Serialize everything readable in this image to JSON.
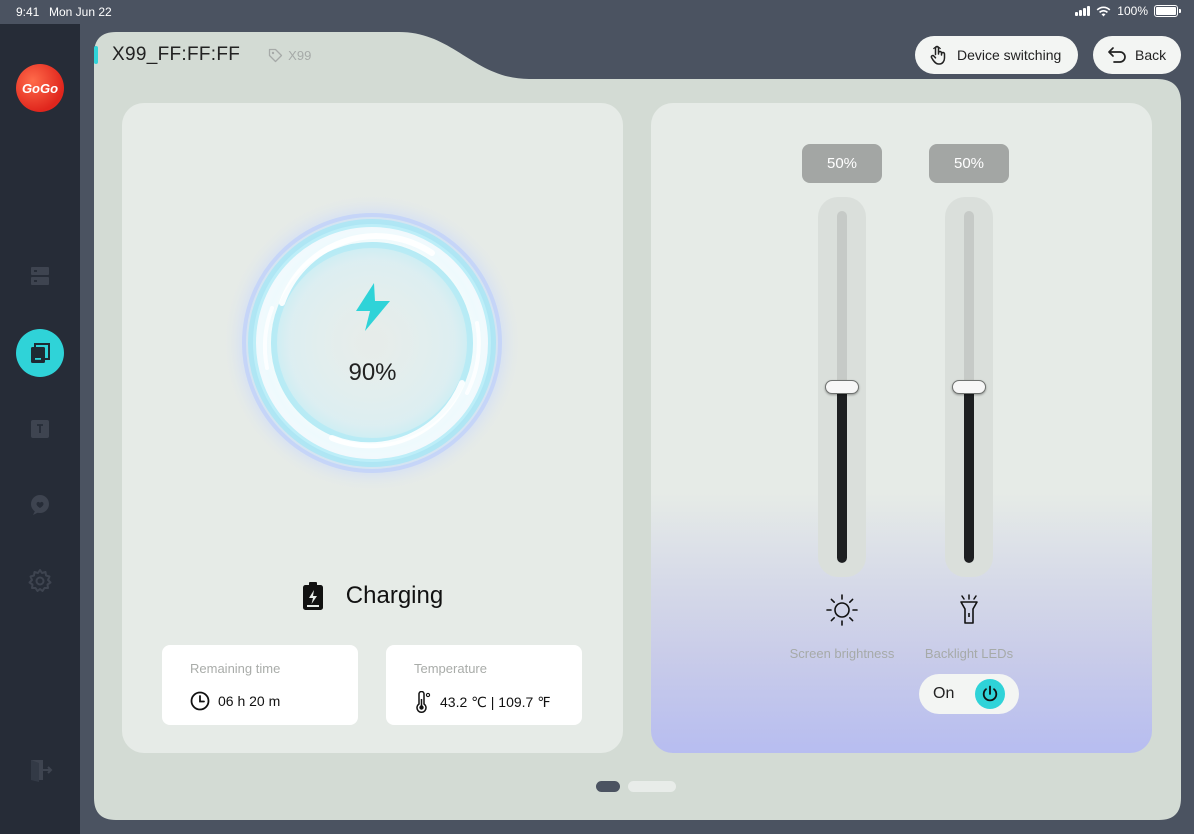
{
  "status_bar": {
    "time": "9:41",
    "date": "Mon Jun 22",
    "battery": "100%"
  },
  "app": {
    "logo_text": "GoGo"
  },
  "sidebar": {
    "items": [
      {
        "icon": "server-icon",
        "active": false
      },
      {
        "icon": "device-icon",
        "active": true
      },
      {
        "icon": "text-box-icon",
        "active": false
      },
      {
        "icon": "chat-icon",
        "active": false
      },
      {
        "icon": "gear-icon",
        "active": false
      },
      {
        "icon": "logout-icon",
        "active": false
      }
    ],
    "accent_color": "#2fd3d8"
  },
  "header": {
    "device_name": "X99_FF:FF:FF",
    "tag": "X99",
    "device_switching_label": "Device switching",
    "back_label": "Back"
  },
  "battery_panel": {
    "percent": "90%",
    "status": "Charging",
    "remaining_time": {
      "label": "Remaining time",
      "value": "06 h 20 m"
    },
    "temperature": {
      "label": "Temperature",
      "value": "43.2 ℃ | 109.7 ℉"
    }
  },
  "lights_panel": {
    "screen_brightness": {
      "label": "Screen brightness",
      "value_text": "50%",
      "level": 0.5
    },
    "backlight_leds": {
      "label": "Backlight LEDs",
      "value_text": "50%",
      "level": 0.5
    },
    "toggle": {
      "label": "On",
      "state": "on"
    }
  },
  "pager": {
    "count": 2,
    "current": 0
  }
}
